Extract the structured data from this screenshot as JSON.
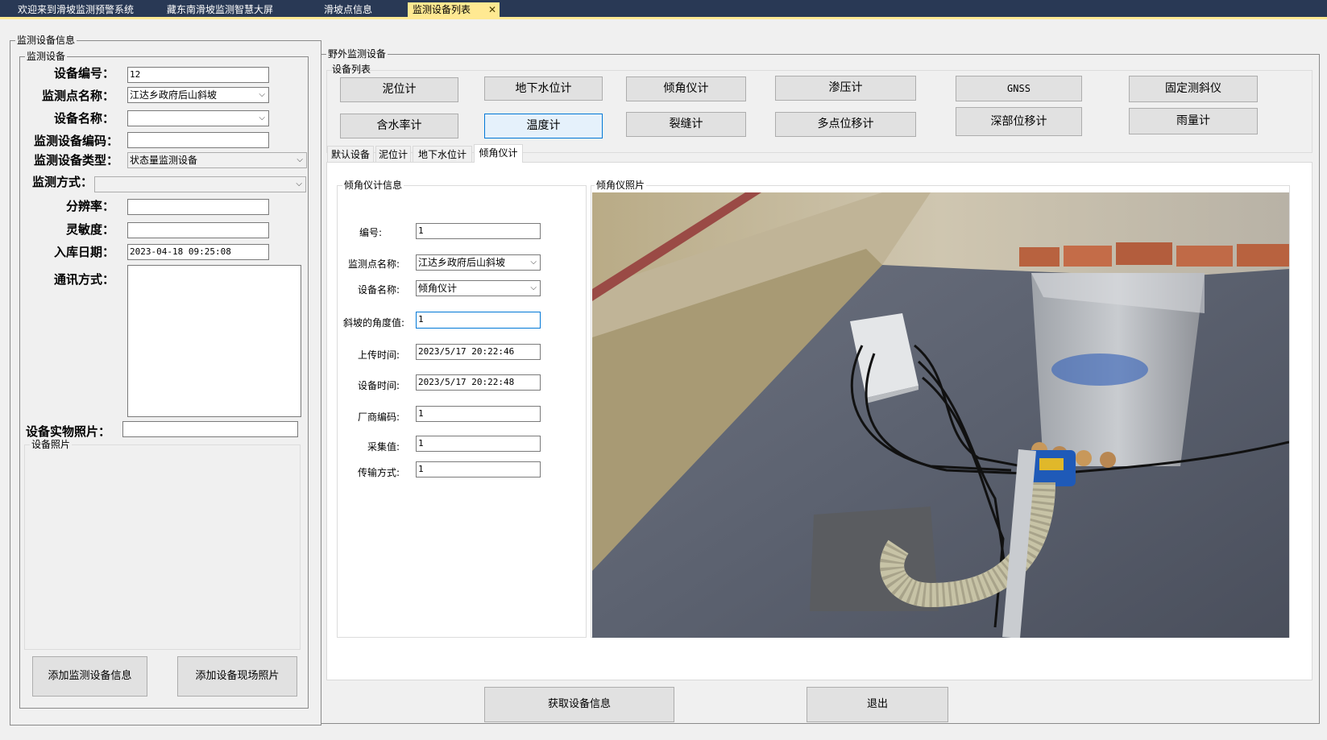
{
  "tabs": [
    {
      "label": "欢迎来到滑坡监测预警系统",
      "active": false
    },
    {
      "label": "藏东南滑坡监测智慧大屏",
      "active": false
    },
    {
      "label": "滑坡点信息",
      "active": false
    },
    {
      "label": "监测设备列表",
      "active": true
    }
  ],
  "close_glyph": "✕",
  "left": {
    "group_title": "监测设备信息",
    "inner_title": "监测设备",
    "device_no_label": "设备编号：",
    "device_no_value": "12",
    "point_name_label": "监测点名称：",
    "point_name_value": "江达乡政府后山斜坡",
    "device_name_label": "设备名称：",
    "device_name_value": "",
    "device_code_label": "监测设备编码：",
    "device_code_value": "",
    "device_type_label": "监测设备类型：",
    "device_type_value": "状态量监测设备",
    "method_label": "监测方式：",
    "method_value": "",
    "resolution_label": "分辨率：",
    "resolution_value": "",
    "sensitivity_label": "灵敏度：",
    "sensitivity_value": "",
    "storage_date_label": "入库日期：",
    "storage_date_value": "2023-04-18 09:25:08",
    "comm_label": "通讯方式：",
    "comm_value": "",
    "photo_label": "设备实物照片：",
    "photo_value": "",
    "photo_group_title": "设备照片",
    "add_info_button": "添加监测设备信息",
    "add_photo_button": "添加设备现场照片"
  },
  "right": {
    "group_title": "野外监测设备",
    "list_title": "设备列表",
    "device_buttons_row1": [
      "泥位计",
      "地下水位计",
      "倾角仪计",
      "渗压计",
      "GNSS",
      "固定测斜仪"
    ],
    "device_buttons_row2": [
      "含水率计",
      "温度计",
      "裂缝计",
      "多点位移计",
      "深部位移计",
      "雨量计"
    ],
    "selected_button": "温度计",
    "inner_tabs": [
      "默认设备",
      "泥位计",
      "地下水位计",
      "倾角仪计"
    ],
    "active_inner_tab": "倾角仪计",
    "info_title": "倾角仪计信息",
    "photo_title": "倾角仪照片",
    "fields": [
      {
        "label": "编号:",
        "value": "1",
        "type": "text"
      },
      {
        "label": "监测点名称:",
        "value": "江达乡政府后山斜坡",
        "type": "combo"
      },
      {
        "label": "设备名称:",
        "value": "倾角仪计",
        "type": "combo"
      },
      {
        "label": "斜坡的角度值:",
        "value": "1",
        "type": "focus"
      },
      {
        "label": "上传时间:",
        "value": "2023/5/17 20:22:46",
        "type": "text"
      },
      {
        "label": "设备时间:",
        "value": "2023/5/17 20:22:48",
        "type": "text"
      },
      {
        "label": "厂商编码:",
        "value": "1",
        "type": "text"
      },
      {
        "label": "采集值:",
        "value": "1",
        "type": "text"
      },
      {
        "label": "传输方式:",
        "value": "1",
        "type": "text"
      }
    ],
    "get_info_button": "获取设备信息",
    "exit_button": "退出"
  },
  "colors": {
    "tabbar_bg": "#293955",
    "active_tab": "#ffe992",
    "window_bg": "#f0f0f0",
    "button_bg": "#e1e1e1",
    "selected_border": "#0078d7"
  }
}
